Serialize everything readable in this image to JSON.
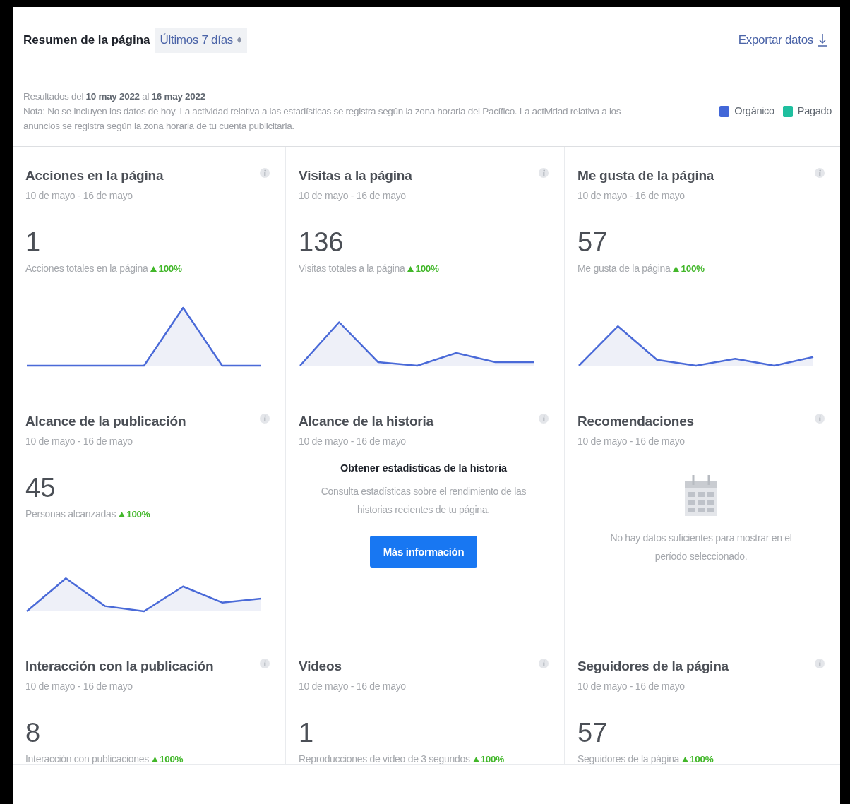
{
  "header": {
    "title": "Resumen de la página",
    "range_selector": "Últimos 7 días",
    "export_link": "Exportar datos"
  },
  "note": {
    "results": "Resultados del **10 may 2022** al **16 may 2022**",
    "text": "Nota: No se incluyen los datos de hoy. La actividad relativa a las estadísticas se registra según la zona horaria del Pacífico. La actividad relativa a los anuncios se registra según la zona horaria de tu cuenta publicitaria.",
    "legend": [
      {
        "label": "Orgánico",
        "color": "#4267d8"
      },
      {
        "label": "Pagado",
        "color": "#1fbf9f"
      }
    ]
  },
  "cards": [
    {
      "kind": "metric",
      "title": "Acciones en la página",
      "date_range": "10 de mayo - 16 de mayo",
      "value": "1",
      "caption": "Acciones totales en la página",
      "change": "100%"
    },
    {
      "kind": "metric",
      "title": "Visitas a la página",
      "date_range": "10 de mayo - 16 de mayo",
      "value": "136",
      "caption": "Visitas totales a la página",
      "change": "100%"
    },
    {
      "kind": "metric",
      "title": "Me gusta de la página",
      "date_range": "10 de mayo - 16 de mayo",
      "value": "57",
      "caption": "Me gusta de la página",
      "change": "100%"
    },
    {
      "kind": "metric",
      "title": "Alcance de la publicación",
      "date_range": "10 de mayo - 16 de mayo",
      "value": "45",
      "caption": "Personas alcanzadas",
      "change": "100%"
    },
    {
      "kind": "promo",
      "title": "Alcance de la historia",
      "date_range": "10 de mayo - 16 de mayo",
      "heading": "Obtener estadísticas de la historia",
      "text": "Consulta estadísticas sobre el rendimiento de las historias recientes de tu página.",
      "button": "Más información"
    },
    {
      "kind": "empty",
      "title": "Recomendaciones",
      "date_range": "10 de mayo - 16 de mayo",
      "text": "No hay datos suficientes para mostrar en el período seleccionado."
    },
    {
      "kind": "metric",
      "title": "Interacción con la publicación",
      "date_range": "10 de mayo - 16 de mayo",
      "value": "8",
      "caption": "Interacción con publicaciones",
      "change": "100%"
    },
    {
      "kind": "metric",
      "title": "Videos",
      "date_range": "10 de mayo - 16 de mayo",
      "value": "1",
      "caption": "Reproducciones de video de 3 segundos",
      "change": "100%"
    },
    {
      "kind": "metric",
      "title": "Seguidores de la página",
      "date_range": "10 de mayo - 16 de mayo",
      "value": "57",
      "caption": "Seguidores de la página",
      "change": "100%"
    }
  ]
}
